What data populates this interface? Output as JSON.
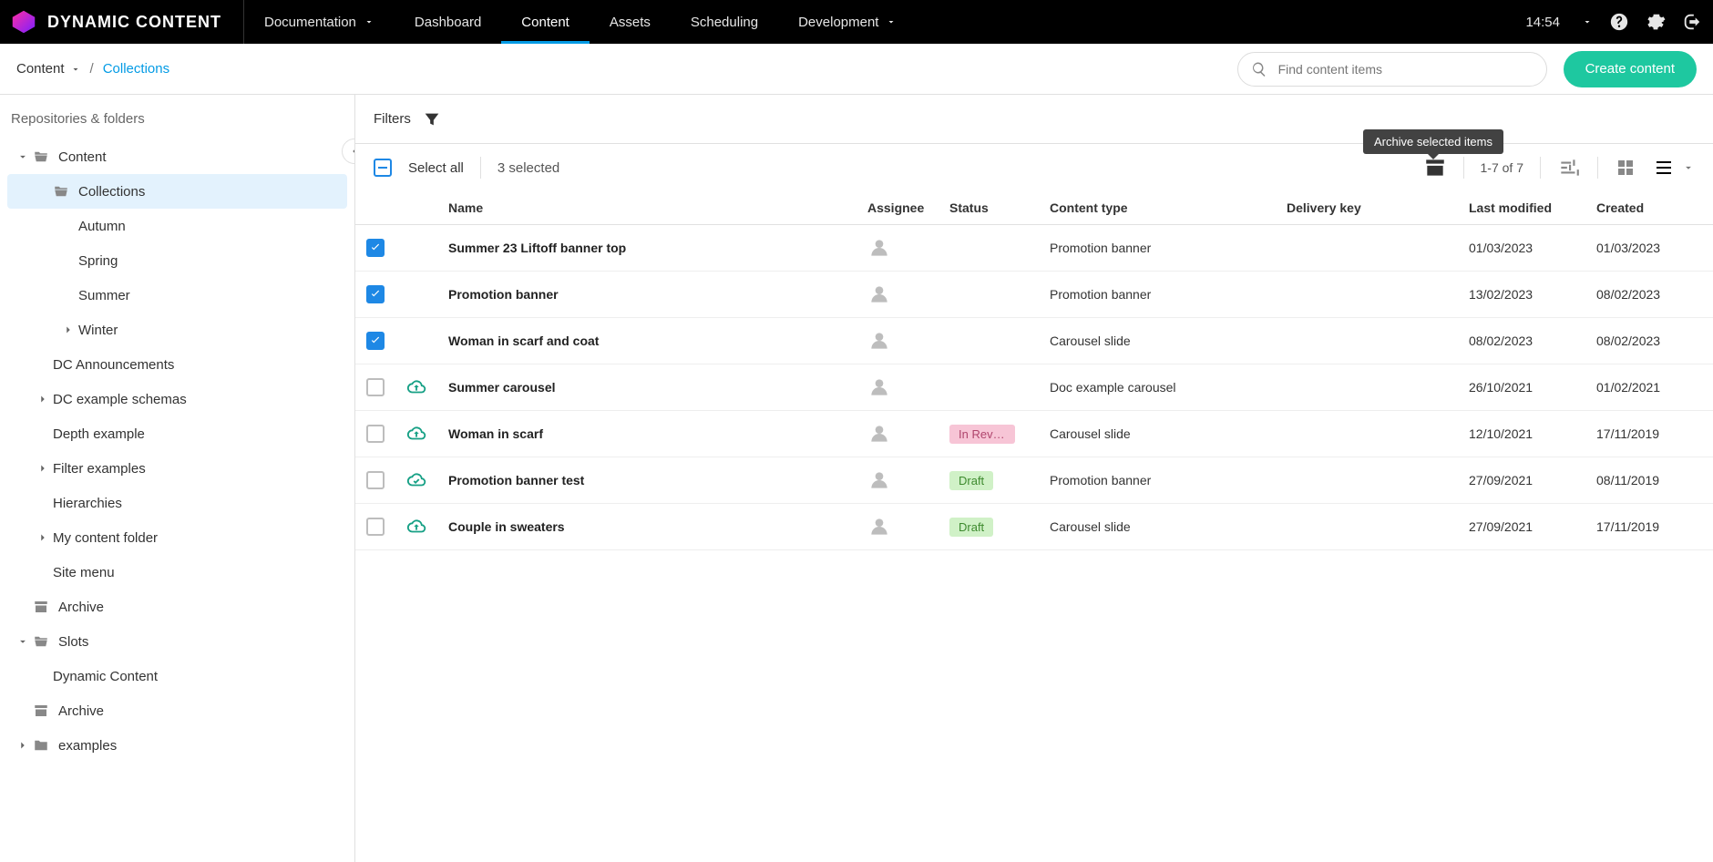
{
  "brand": {
    "name": "DYNAMIC CONTENT"
  },
  "nav": {
    "items": [
      {
        "label": "Documentation",
        "hasCaret": true,
        "active": false
      },
      {
        "label": "Dashboard",
        "hasCaret": false,
        "active": false
      },
      {
        "label": "Content",
        "hasCaret": false,
        "active": true
      },
      {
        "label": "Assets",
        "hasCaret": false,
        "active": false
      },
      {
        "label": "Scheduling",
        "hasCaret": false,
        "active": false
      },
      {
        "label": "Development",
        "hasCaret": true,
        "active": false
      }
    ],
    "clock": "14:54"
  },
  "breadcrumb": {
    "root": "Content",
    "sep": "/",
    "current": "Collections"
  },
  "search": {
    "placeholder": "Find content items"
  },
  "actions": {
    "create": "Create content"
  },
  "sidebar": {
    "title": "Repositories & folders",
    "tree": [
      {
        "label": "Content",
        "depth": 0,
        "open": true,
        "icon": "folder-open"
      },
      {
        "label": "Collections",
        "depth": 1,
        "open": true,
        "selected": true,
        "icon": "folder-open",
        "showToggle": false
      },
      {
        "label": "Autumn",
        "depth": 2,
        "icon": "dot",
        "showToggle": false
      },
      {
        "label": "Spring",
        "depth": 2,
        "icon": "dot",
        "showToggle": false
      },
      {
        "label": "Summer",
        "depth": 2,
        "icon": "dot",
        "showToggle": false
      },
      {
        "label": "Winter",
        "depth": 2,
        "icon": "dot",
        "showToggle": true,
        "open": false
      },
      {
        "label": "DC Announcements",
        "depth": 1,
        "icon": "dot",
        "showToggle": false
      },
      {
        "label": "DC example schemas",
        "depth": 1,
        "icon": "dot",
        "showToggle": true,
        "open": false
      },
      {
        "label": "Depth example",
        "depth": 1,
        "icon": "dot",
        "showToggle": false
      },
      {
        "label": "Filter examples",
        "depth": 1,
        "icon": "dot",
        "showToggle": true,
        "open": false
      },
      {
        "label": "Hierarchies",
        "depth": 1,
        "icon": "dot",
        "showToggle": false
      },
      {
        "label": "My content folder",
        "depth": 1,
        "icon": "dot",
        "showToggle": true,
        "open": false
      },
      {
        "label": "Site menu",
        "depth": 1,
        "icon": "dot",
        "showToggle": false
      },
      {
        "label": "Archive",
        "depth": 0,
        "icon": "archive",
        "showToggle": false
      },
      {
        "label": "Slots",
        "depth": 0,
        "open": true,
        "icon": "folder-open"
      },
      {
        "label": "Dynamic Content",
        "depth": 1,
        "icon": "dot",
        "showToggle": false
      },
      {
        "label": "Archive",
        "depth": 0,
        "icon": "archive",
        "showToggle": false
      },
      {
        "label": "examples",
        "depth": 0,
        "icon": "folder-closed",
        "showToggle": true,
        "open": false
      }
    ]
  },
  "filters": {
    "label": "Filters"
  },
  "selection": {
    "selectAllLabel": "Select all",
    "count": "3 selected",
    "paging": "1-7 of 7",
    "tooltip": "Archive selected items"
  },
  "columns": {
    "name": "Name",
    "assignee": "Assignee",
    "status": "Status",
    "type": "Content type",
    "key": "Delivery key",
    "modified": "Last modified",
    "created": "Created"
  },
  "rows": [
    {
      "checked": true,
      "icon": "none",
      "name": "Summer 23 Liftoff banner top",
      "status": "",
      "statusKind": "",
      "type": "Promotion banner",
      "key": "",
      "modified": "01/03/2023",
      "created": "01/03/2023"
    },
    {
      "checked": true,
      "icon": "none",
      "name": "Promotion banner",
      "status": "",
      "statusKind": "",
      "type": "Promotion banner",
      "key": "",
      "modified": "13/02/2023",
      "created": "08/02/2023"
    },
    {
      "checked": true,
      "icon": "none",
      "name": "Woman in scarf and coat",
      "status": "",
      "statusKind": "",
      "type": "Carousel slide",
      "key": "",
      "modified": "08/02/2023",
      "created": "08/02/2023"
    },
    {
      "checked": false,
      "icon": "up",
      "name": "Summer carousel",
      "status": "",
      "statusKind": "",
      "type": "Doc example carousel",
      "key": "",
      "modified": "26/10/2021",
      "created": "01/02/2021"
    },
    {
      "checked": false,
      "icon": "up",
      "name": "Woman in scarf",
      "status": "In Review",
      "statusKind": "pink",
      "type": "Carousel slide",
      "key": "",
      "modified": "12/10/2021",
      "created": "17/11/2019"
    },
    {
      "checked": false,
      "icon": "ok",
      "name": "Promotion banner test",
      "status": "Draft",
      "statusKind": "green",
      "type": "Promotion banner",
      "key": "",
      "modified": "27/09/2021",
      "created": "08/11/2019"
    },
    {
      "checked": false,
      "icon": "up",
      "name": "Couple in sweaters",
      "status": "Draft",
      "statusKind": "green",
      "type": "Carousel slide",
      "key": "",
      "modified": "27/09/2021",
      "created": "17/11/2019"
    }
  ]
}
